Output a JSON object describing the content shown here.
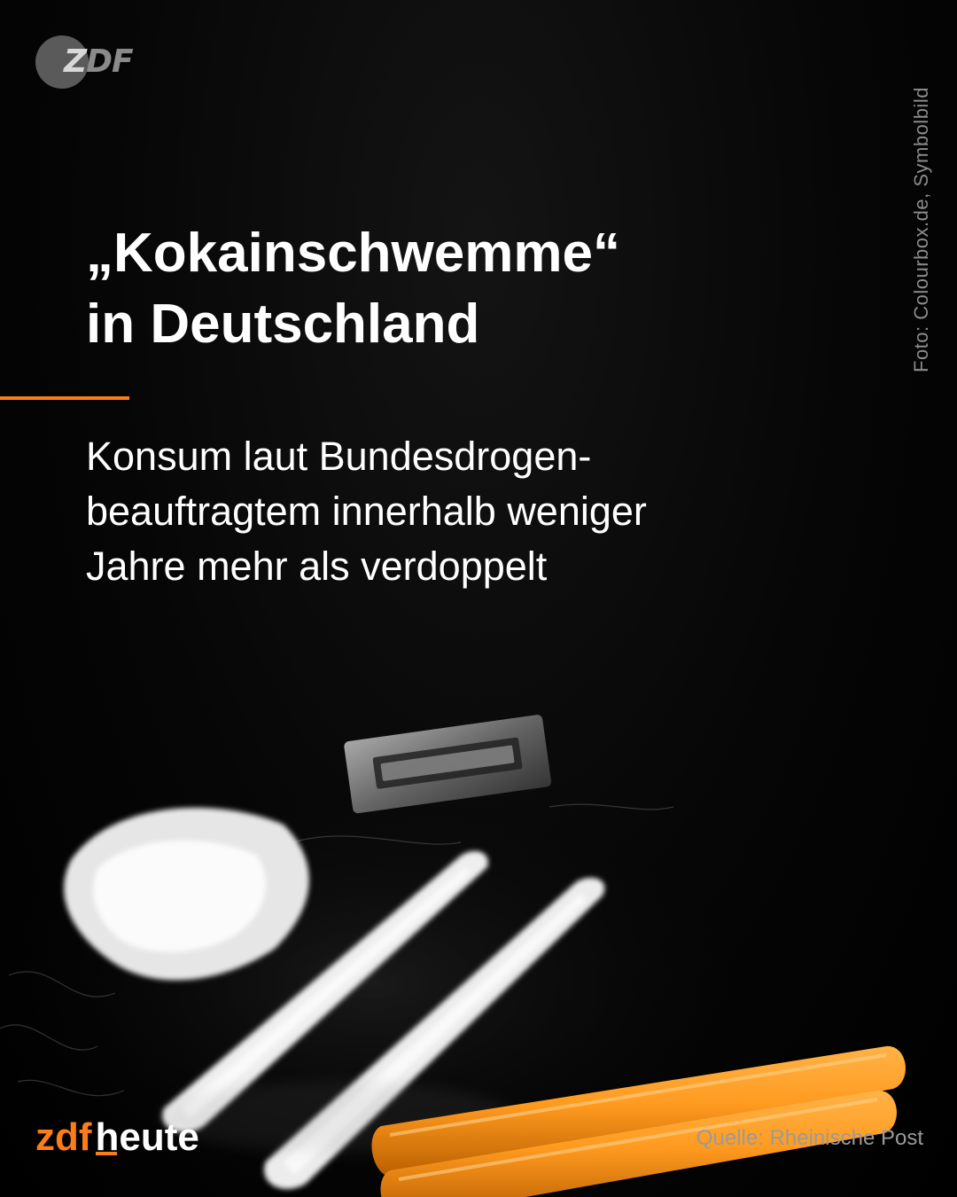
{
  "logo": {
    "text": "ZDF"
  },
  "photo_credit": "Foto: Colourbox.de, Symbolbild",
  "headline": {
    "line1": "„Kokainschwemme“",
    "line2": "in Deutschland"
  },
  "subline": {
    "line1": "Konsum laut Bundesdrogen-",
    "line2": "beauftragtem innerhalb weniger",
    "line3": "Jahre mehr als verdoppelt"
  },
  "brand": {
    "part1": "zdf",
    "part2": "heute"
  },
  "source": "Quelle: Rheinische Post",
  "colors": {
    "accent": "#fa7d19",
    "background": "#000000",
    "text": "#ffffff"
  }
}
